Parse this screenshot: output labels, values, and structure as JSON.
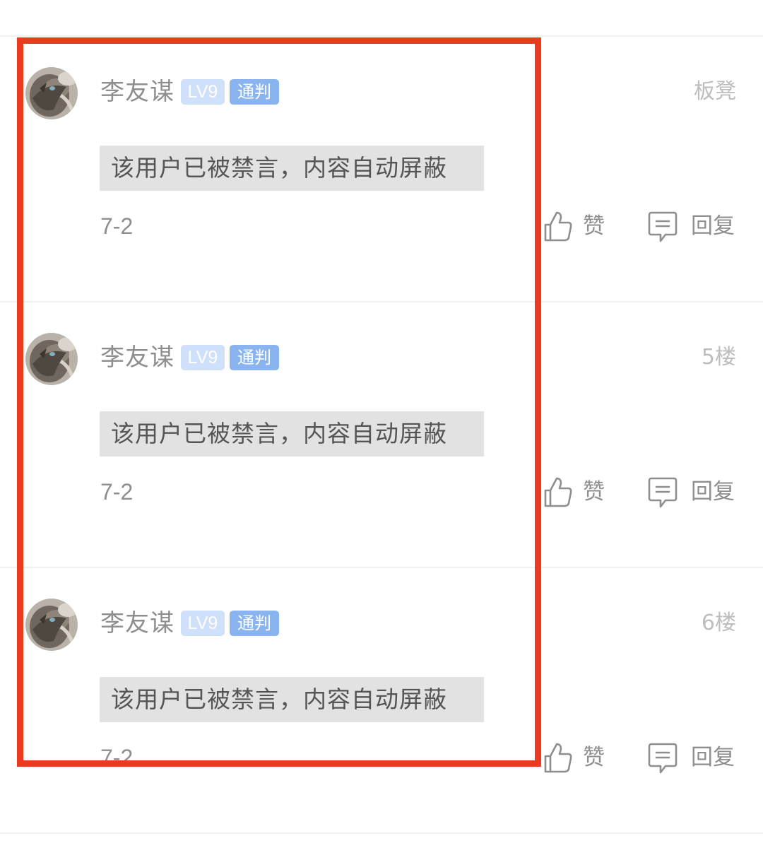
{
  "comments": [
    {
      "username": "李友谋",
      "level_badge": "LV9",
      "role_badge": "通判",
      "floor": "板凳",
      "content": "该用户已被禁言，内容自动屏蔽",
      "date": "7-2",
      "like_label": "赞",
      "reply_label": "回复"
    },
    {
      "username": "李友谋",
      "level_badge": "LV9",
      "role_badge": "通判",
      "floor": "5楼",
      "content": "该用户已被禁言，内容自动屏蔽",
      "date": "7-2",
      "like_label": "赞",
      "reply_label": "回复"
    },
    {
      "username": "李友谋",
      "level_badge": "LV9",
      "role_badge": "通判",
      "floor": "6楼",
      "content": "该用户已被禁言，内容自动屏蔽",
      "date": "7-2",
      "like_label": "赞",
      "reply_label": "回复"
    }
  ],
  "icons": {
    "like": "thumbs-up-icon",
    "reply": "comment-bubble-icon"
  },
  "colors": {
    "highlight_border": "#ea3a1f",
    "level_badge_bg": "#cfe0fa",
    "role_badge_bg": "#8ab4f0",
    "banned_bg": "#e2e2e2"
  }
}
